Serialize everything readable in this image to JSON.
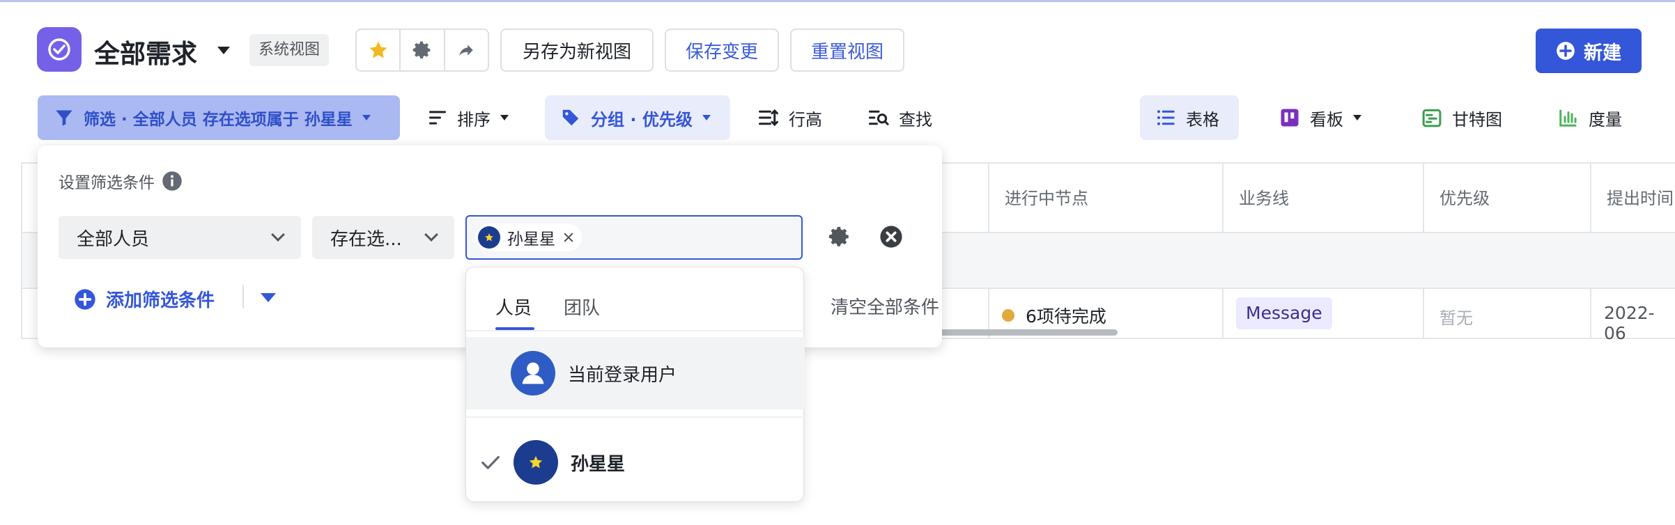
{
  "header": {
    "title": "全部需求",
    "badge": "系统视图",
    "save_as_new": "另存为新视图",
    "save_changes": "保存变更",
    "reset_view": "重置视图",
    "new_button": "新建"
  },
  "toolbar": {
    "filter_label": "筛选 · 全部人员 存在选项属于 孙星星",
    "sort_label": "排序",
    "group_label": "分组 · 优先级",
    "row_height_label": "行高",
    "find_label": "查找",
    "views": {
      "table": "表格",
      "kanban": "看板",
      "gantt": "甘特图",
      "measure": "度量"
    }
  },
  "table": {
    "headers": [
      "进行中节点",
      "业务线",
      "优先级",
      "提出时间"
    ],
    "row": {
      "progress": "6项待完成",
      "business_line": "Message",
      "priority": "暂无",
      "created": "2022-06"
    }
  },
  "filter_panel": {
    "title": "设置筛选条件",
    "field_select": "全部人员",
    "operator_select": "存在选...",
    "selected_chip": "孙星星",
    "add_condition": "添加筛选条件",
    "clear_all": "清空全部条件"
  },
  "people_dropdown": {
    "tabs": [
      "人员",
      "团队"
    ],
    "items": [
      {
        "label": "当前登录用户",
        "selected": false
      },
      {
        "label": "孙星星",
        "selected": true
      }
    ]
  },
  "colors": {
    "accent": "#3456d8",
    "app_icon": "#7461e8",
    "status_dot": "#e2a93b"
  }
}
